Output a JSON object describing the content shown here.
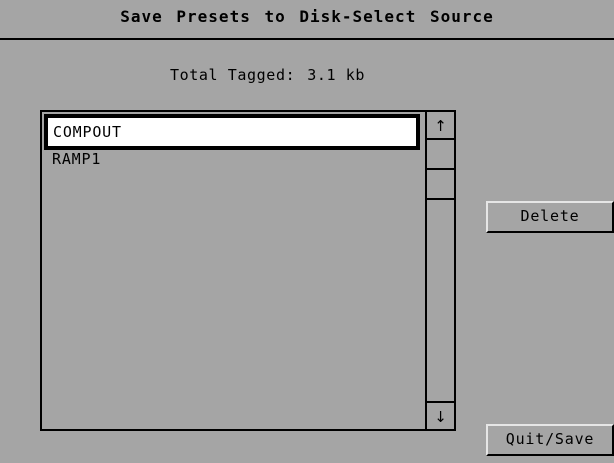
{
  "window": {
    "title": "Save Presets to Disk-Select Source"
  },
  "summary": {
    "label": "Total Tagged:",
    "value": "3.1 kb"
  },
  "list": {
    "items": [
      {
        "label": "COMPOUT",
        "selected": true
      },
      {
        "label": "RAMP1",
        "selected": false
      }
    ]
  },
  "scrollbar": {
    "up_glyph": "↑",
    "down_glyph": "↓"
  },
  "buttons": {
    "delete_label": "Delete",
    "quit_label": "Quit/Save"
  }
}
